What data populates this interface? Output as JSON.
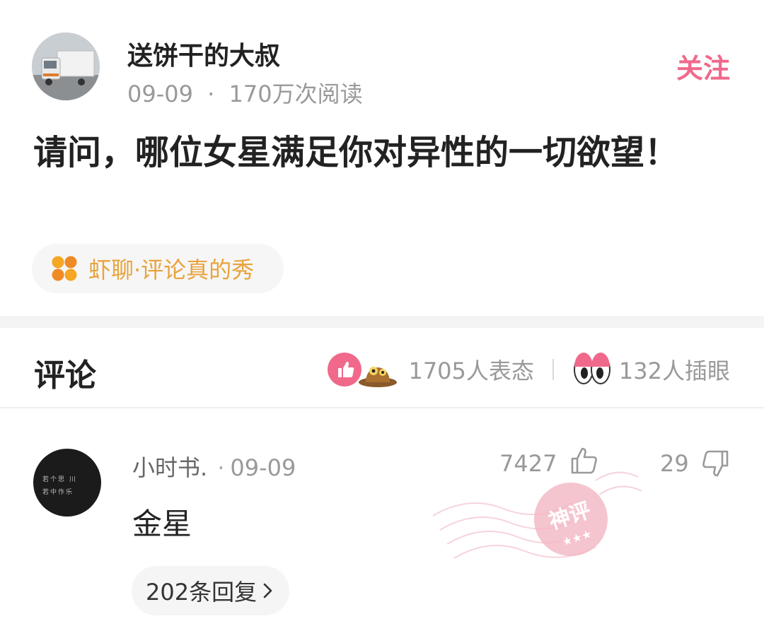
{
  "post": {
    "author": "送饼干的大叔",
    "date": "09-09",
    "meta_separator": "·",
    "reads": "170万次阅读",
    "follow_label": "关注",
    "title": "请问，哪位女星满足你对异性的一切欲望！",
    "topic": "虾聊·评论真的秀"
  },
  "comments_section": {
    "heading": "评论",
    "reactions_count": "1705人表态",
    "poke_count": "132人插眼"
  },
  "comment": {
    "author": "小时书.",
    "separator": "·",
    "date": "09-09",
    "likes": "7427",
    "dislikes": "29",
    "text": "金星",
    "replies": "202条回复",
    "avatar_text_1": "若个思 川",
    "avatar_text_2": "若中作乐",
    "badge": "神评"
  },
  "icons": {
    "topic": "clover-icon",
    "like": "thumb-up-icon",
    "dislike": "thumb-down-icon",
    "reaction_like": "like-reaction-icon",
    "reaction_mole": "mole-reaction-icon",
    "eyes": "eyes-icon",
    "chevron": "chevron-right-icon"
  },
  "colors": {
    "accent": "#f0698b",
    "topic": "#e8a33c",
    "muted": "#999999"
  }
}
